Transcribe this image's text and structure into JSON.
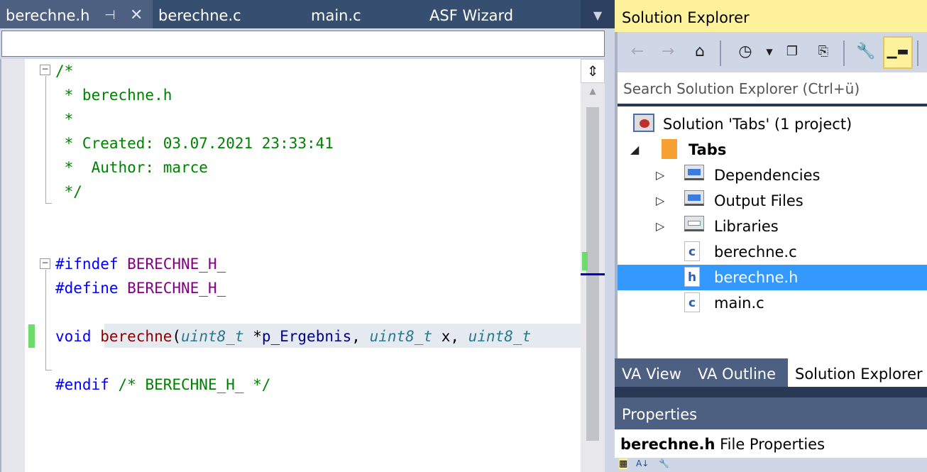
{
  "editor_tabs": [
    {
      "label": "berechne.h",
      "active": true
    },
    {
      "label": "berechne.c"
    },
    {
      "label": "main.c"
    },
    {
      "label": "ASF Wizard"
    }
  ],
  "icons": {
    "pin": "pin-icon",
    "close": "close-icon",
    "dropdown": "chevron-down-icon"
  },
  "code": [
    [
      [
        "c",
        "/*"
      ]
    ],
    [
      [
        "c",
        " * berechne.h"
      ]
    ],
    [
      [
        "c",
        " *"
      ]
    ],
    [
      [
        "c",
        " * Created: 03.07.2021 23:33:41"
      ]
    ],
    [
      [
        "c",
        " *  Author: marce"
      ]
    ],
    [
      [
        "c",
        " */"
      ]
    ],
    [],
    [],
    [
      [
        "k",
        "#ifndef "
      ],
      [
        "m",
        "BERECHNE_H_"
      ]
    ],
    [
      [
        "k",
        "#define "
      ],
      [
        "m",
        "BERECHNE_H_"
      ]
    ],
    [],
    [
      [
        "k",
        "void "
      ],
      [
        "f",
        "berechne"
      ],
      [
        "p",
        "("
      ],
      [
        "t",
        "uint8_t"
      ],
      [
        "p",
        " *"
      ],
      [
        "v",
        "p_Ergebnis"
      ],
      [
        "p",
        ", "
      ],
      [
        "t",
        "uint8_t"
      ],
      [
        "p",
        " x, "
      ],
      [
        "t",
        "uint8_t"
      ]
    ],
    [],
    [
      [
        "k",
        "#endif "
      ],
      [
        "c",
        "/* BERECHNE_H_ */"
      ]
    ]
  ],
  "solution_explorer": {
    "title": "Solution Explorer",
    "search_placeholder": "Search Solution Explorer (Ctrl+ü)",
    "tree": [
      {
        "label": "Solution 'Tabs' (1 project)",
        "level": 0,
        "icon": "solution-icon"
      },
      {
        "label": "Tabs",
        "level": 1,
        "icon": "gcc-project-icon",
        "expanded": true,
        "bold": true
      },
      {
        "label": "Dependencies",
        "level": 2,
        "icon": "folder-icon",
        "collapsed": true
      },
      {
        "label": "Output Files",
        "level": 2,
        "icon": "folder-icon",
        "collapsed": true
      },
      {
        "label": "Libraries",
        "level": 2,
        "icon": "library-folder-icon",
        "collapsed": true
      },
      {
        "label": "berechne.c",
        "level": 2,
        "icon": "c-file-icon"
      },
      {
        "label": "berechne.h",
        "level": 2,
        "icon": "h-file-icon",
        "selected": true
      },
      {
        "label": "main.c",
        "level": 2,
        "icon": "c-file-icon"
      }
    ],
    "bottom_tabs": [
      "VA View",
      "VA Outline",
      "Solution Explorer"
    ]
  },
  "properties": {
    "title": "Properties",
    "object_name": "berechne.h",
    "object_type": "File Properties"
  },
  "colors": {
    "selection": "#3399ff",
    "title_active": "#fff29d",
    "tab_bg": "#364e6f"
  }
}
